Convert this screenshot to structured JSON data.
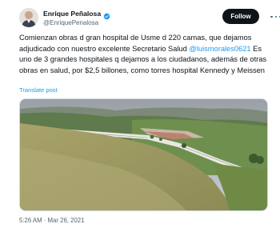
{
  "author": {
    "display_name": "Enrique Peñalosa",
    "handle": "@EnriquePenalosa",
    "verified": true
  },
  "follow_label": "Follow",
  "tweet": {
    "text_before": "Comienzan obras d gran hospital de Usme d 220 camas, que dejamos adjudicado con nuestro excelente Secretario Salud ",
    "mention": "@luismorales0621",
    "text_after": " Es uno de 3 grandes hospitales q dejamos a los ciudadanos, además de otras obras en salud, por $2,5 billones, como torres hospital Kennedy y Meissen",
    "translate_label": "Translate post",
    "timestamp": "5:26 AM · Mar 26, 2021"
  },
  "colors": {
    "accent": "#1d9bf0",
    "text": "#0f1419",
    "secondary": "#536471",
    "follow_bg": "#0f1419"
  },
  "icons": [
    "verified-badge-icon",
    "more-options-icon"
  ]
}
